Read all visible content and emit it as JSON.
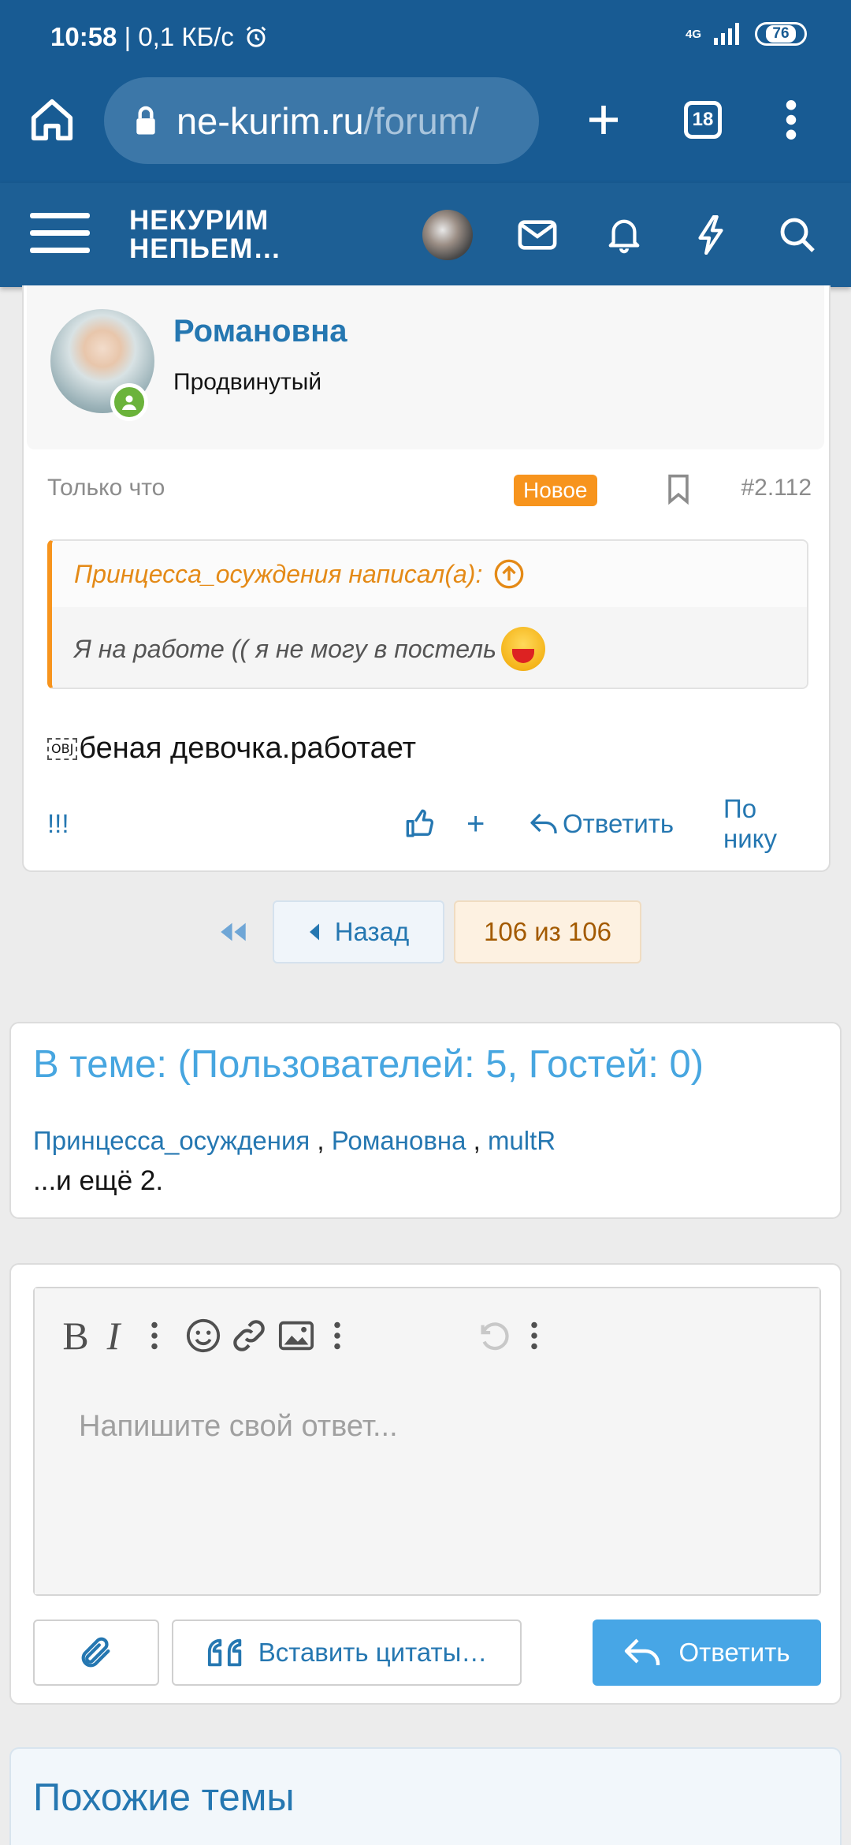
{
  "status_bar": {
    "time": "10:58",
    "network_speed": "| 0,1 КБ/с",
    "network_type": "4G",
    "battery": "76"
  },
  "browser": {
    "url_domain": "ne-kurim.ru",
    "url_path": "/forum/",
    "tabs_count": "18"
  },
  "forum_header": {
    "logo_line1": "НЕКУРИМ",
    "logo_line2": "НЕПЬЕМ…"
  },
  "post": {
    "author": "Романовна",
    "rank": "Продвинутый",
    "time": "Только что",
    "new_badge": "Новое",
    "number": "#2.112",
    "quote_author": "Принцесса_осуждения написал(а):",
    "quote_text": "Я на работе (( я не могу в постель",
    "obj_marker": "OBJ",
    "body": "беная девочка.работает",
    "actions": {
      "flag": "!!!",
      "plus": "+",
      "reply": "Ответить",
      "by_nick": "По нику"
    }
  },
  "pagination": {
    "prev": "Назад",
    "current": "106 из 106"
  },
  "in_topic": {
    "title": "В теме: (Пользователей: 5, Гостей: 0)",
    "users": [
      "Принцесса_осуждения",
      "Романовна",
      "multR"
    ],
    "separator": " , ",
    "more": "...и ещё 2."
  },
  "reply_form": {
    "placeholder": "Напишите свой ответ...",
    "insert_quotes": "Вставить цитаты…",
    "submit": "Ответить"
  },
  "similar": {
    "title": "Похожие темы"
  },
  "colors": {
    "header_bg": "#185b93",
    "link": "#2577b1",
    "accent_orange": "#f7941d",
    "button_blue": "#47a6e6"
  }
}
